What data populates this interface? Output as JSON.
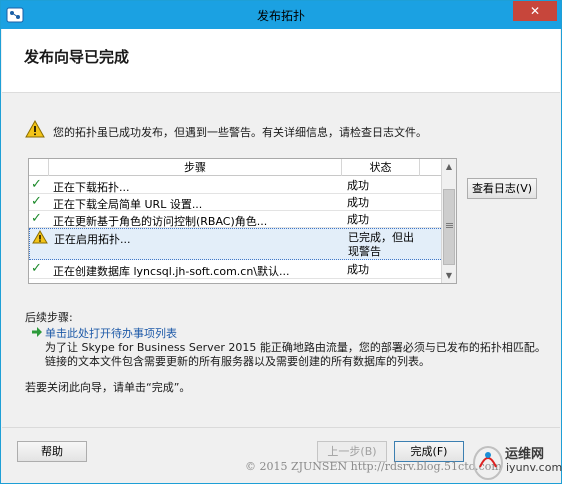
{
  "window": {
    "title": "发布拓扑",
    "close_label": "✕"
  },
  "header": {
    "title": "发布向导已完成"
  },
  "warning": {
    "text": "您的拓扑虽已成功发布，但遇到一些警告。有关详细信息，请检查日志文件。"
  },
  "grid": {
    "columns": {
      "step": "步骤",
      "status": "状态"
    },
    "rows": [
      {
        "icon": "check-icon",
        "step": "正在下载拓扑...",
        "status": "成功"
      },
      {
        "icon": "check-icon",
        "step": "正在下载全局简单 URL 设置...",
        "status": "成功"
      },
      {
        "icon": "check-icon",
        "step": "正在更新基于角色的访问控制(RBAC)角色...",
        "status": "成功"
      },
      {
        "icon": "warning-icon",
        "step": "正在启用拓扑...",
        "status": "已完成，但出现警告"
      },
      {
        "icon": "check-icon",
        "step": "正在创建数据库 lyncsql.jh-soft.com.cn\\默认...",
        "status": "成功"
      }
    ]
  },
  "buttons": {
    "view_logs": "查看日志(V)",
    "help": "帮助",
    "back": "上一步(B)",
    "finish": "完成(F)"
  },
  "next_steps": {
    "title": "后续步骤:",
    "link": "单击此处打开待办事项列表",
    "description_line1": "为了让 Skype for Business Server 2015 能正确地路由流量，您的部署必须与已发布的拓扑相匹配。",
    "description_line2": "链接的文本文件包含需要更新的所有服务器以及需要创建的所有数据库的列表。"
  },
  "close_hint": "若要关闭此向导，请单击“完成”。",
  "watermark": {
    "copyright": "© 2015 ZJUNSEN http://rdsrv.blog.51cto.com",
    "logo_cn": "运维网",
    "logo_en": "iyunv.com"
  },
  "colors": {
    "accent": "#1ba1e2",
    "link": "#1e5aa8",
    "ok": "#1c8a2a",
    "warning": "#e8b400"
  }
}
